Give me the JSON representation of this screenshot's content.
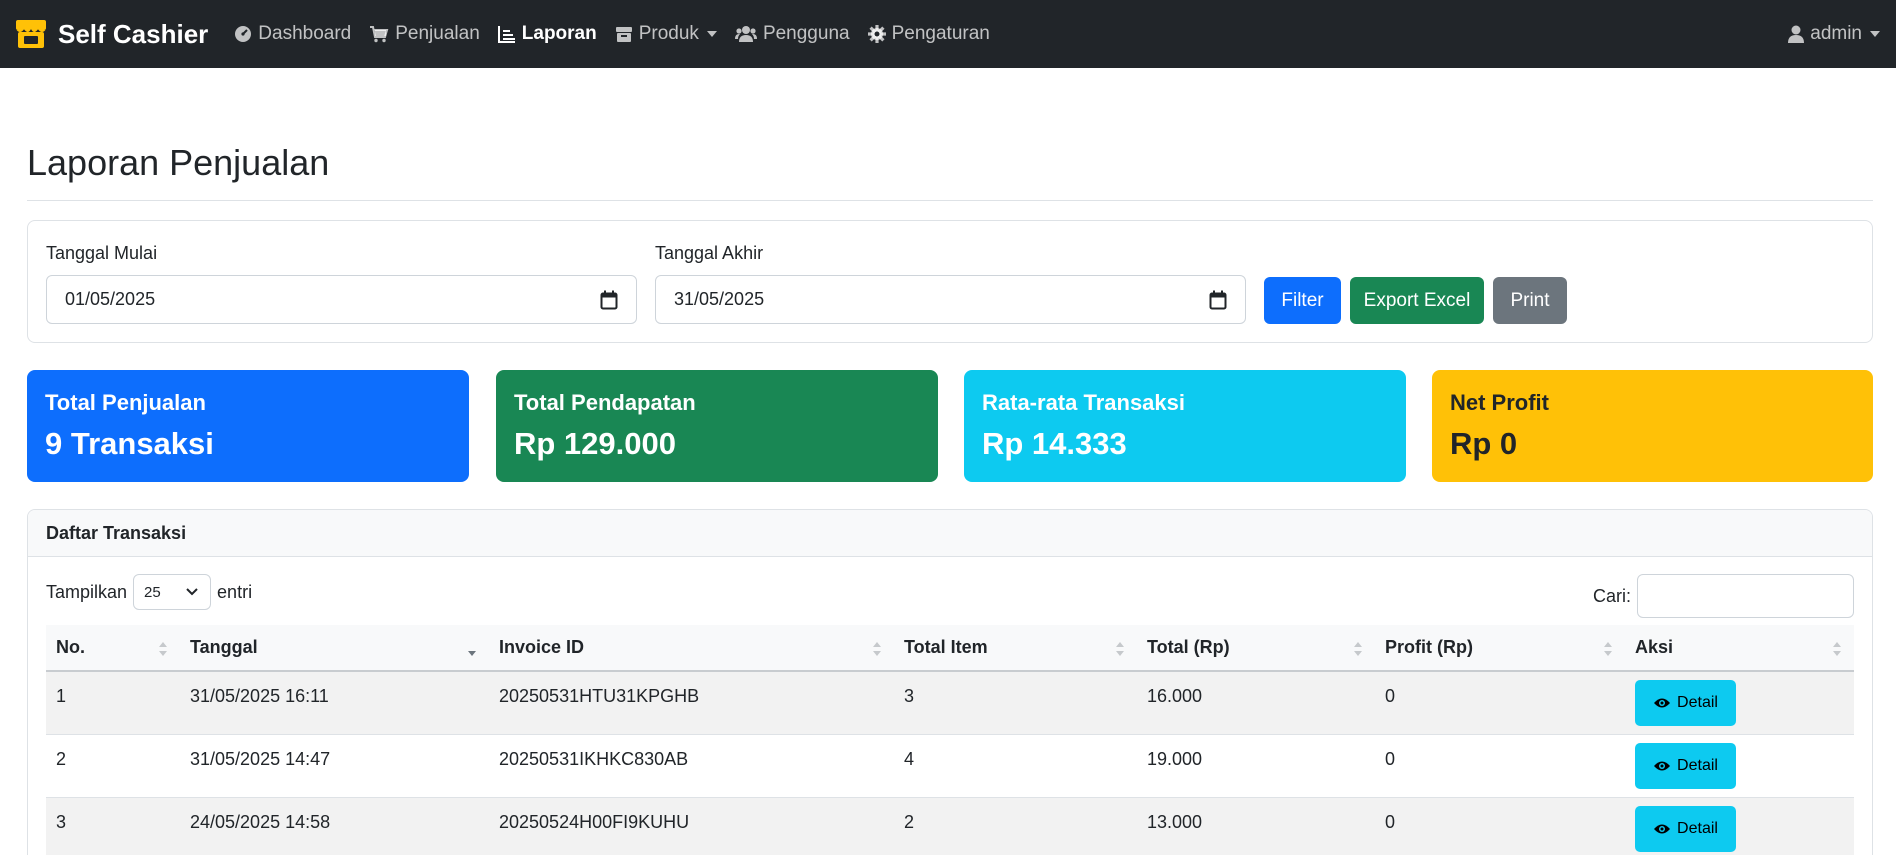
{
  "navbar": {
    "brand": "Self Cashier",
    "items": [
      {
        "label": "Dashboard",
        "icon": "gauge-icon"
      },
      {
        "label": "Penjualan",
        "icon": "cart-icon"
      },
      {
        "label": "Laporan",
        "icon": "chart-icon",
        "active": true
      },
      {
        "label": "Produk",
        "icon": "box-icon",
        "dropdown": true
      },
      {
        "label": "Pengguna",
        "icon": "users-icon"
      },
      {
        "label": "Pengaturan",
        "icon": "gear-icon"
      }
    ],
    "user": "admin"
  },
  "page": {
    "title": "Laporan Penjualan"
  },
  "filter": {
    "start_label": "Tanggal Mulai",
    "start_value": "01/05/2025",
    "end_label": "Tanggal Akhir",
    "end_value": "31/05/2025",
    "filter_button": "Filter",
    "export_button": "Export Excel",
    "print_button": "Print"
  },
  "stats": [
    {
      "label": "Total Penjualan",
      "value": "9 Transaksi",
      "color": "#0d6efd"
    },
    {
      "label": "Total Pendapatan",
      "value": "Rp 129.000",
      "color": "#198754"
    },
    {
      "label": "Rata-rata Transaksi",
      "value": "Rp 14.333",
      "color": "#0dcaf0"
    },
    {
      "label": "Net Profit",
      "value": "Rp 0",
      "color": "#ffc107"
    }
  ],
  "table": {
    "title": "Daftar Transaksi",
    "show_label": "Tampilkan",
    "show_value": "25",
    "entries_label": "entri",
    "search_label": "Cari:",
    "columns": [
      "No.",
      "Tanggal",
      "Invoice ID",
      "Total Item",
      "Total (Rp)",
      "Profit (Rp)",
      "Aksi"
    ],
    "rows": [
      {
        "no": "1",
        "tanggal": "31/05/2025 16:11",
        "invoice": "20250531HTU31KPGHB",
        "items": "3",
        "total": "16.000",
        "profit": "0",
        "action": "Detail"
      },
      {
        "no": "2",
        "tanggal": "31/05/2025 14:47",
        "invoice": "20250531IKHKC830AB",
        "items": "4",
        "total": "19.000",
        "profit": "0",
        "action": "Detail"
      },
      {
        "no": "3",
        "tanggal": "24/05/2025 14:58",
        "invoice": "20250524H00FI9KUHU",
        "items": "2",
        "total": "13.000",
        "profit": "0",
        "action": "Detail"
      }
    ]
  }
}
